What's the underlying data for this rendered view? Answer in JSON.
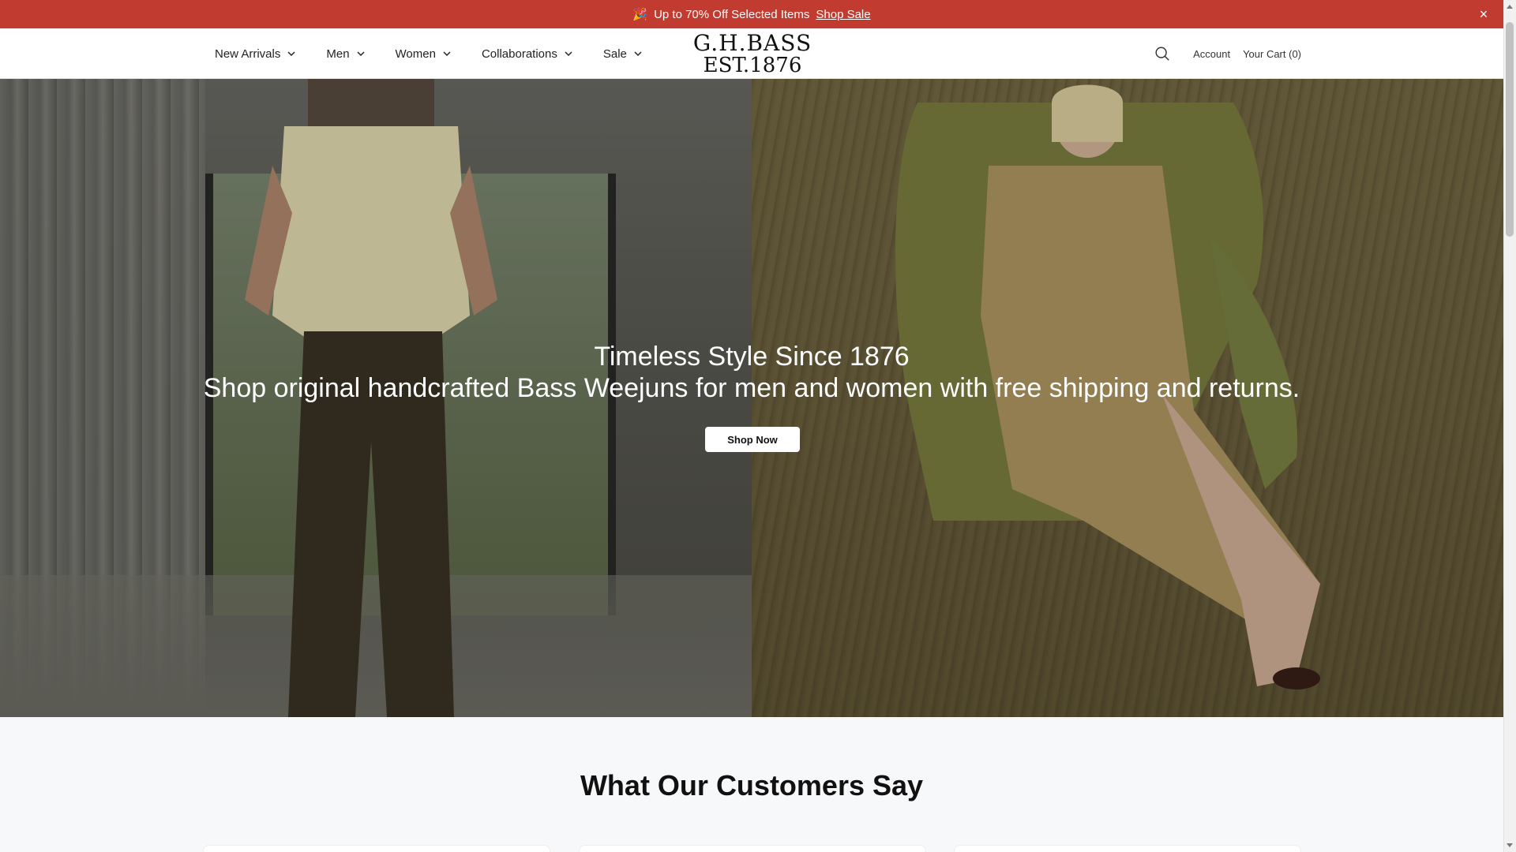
{
  "announcement": {
    "emoji": "🎉",
    "text": "Up to 70% Off Selected Items",
    "link": "Shop Sale",
    "close": "×",
    "bg_color": "#c23b30"
  },
  "nav": {
    "items": [
      {
        "label": "New Arrivals"
      },
      {
        "label": "Men"
      },
      {
        "label": "Women"
      },
      {
        "label": "Collaborations"
      },
      {
        "label": "Sale"
      }
    ]
  },
  "logo": {
    "line1": "G.H.BASS",
    "line2": "EST.1876"
  },
  "header_right": {
    "search_icon": "search-icon",
    "account": "Account",
    "cart": "Your Cart (0)"
  },
  "hero": {
    "title": "Timeless Style Since 1876",
    "subtitle": "Shop original handcrafted Bass Weejuns for men and women with free shipping and returns.",
    "cta": "Shop Now"
  },
  "reviews": {
    "heading": "What Our Customers Say"
  }
}
